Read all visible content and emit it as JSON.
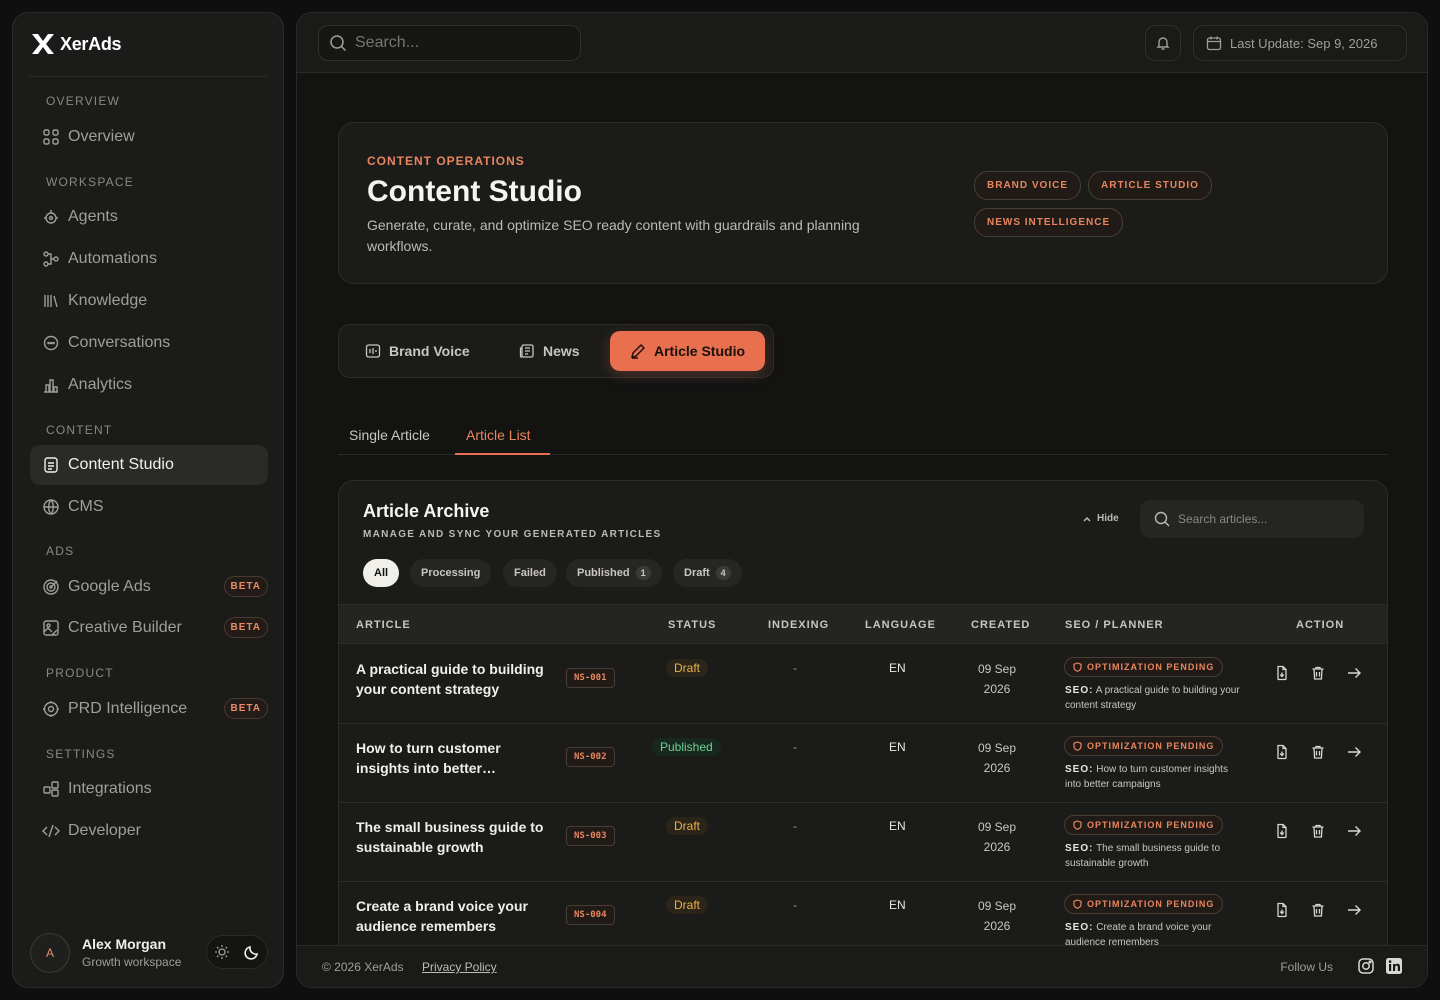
{
  "brand": {
    "name": "XerAds"
  },
  "sidebar": {
    "sections": [
      {
        "title": "OVERVIEW",
        "items": [
          {
            "label": "Overview",
            "icon": "grid-icon"
          }
        ]
      },
      {
        "title": "WORKSPACE",
        "items": [
          {
            "label": "Agents",
            "icon": "agent-icon"
          },
          {
            "label": "Automations",
            "icon": "workflow-icon"
          },
          {
            "label": "Knowledge",
            "icon": "library-icon"
          },
          {
            "label": "Conversations",
            "icon": "chat-icon"
          },
          {
            "label": "Analytics",
            "icon": "bar-chart-icon"
          }
        ]
      },
      {
        "title": "CONTENT",
        "items": [
          {
            "label": "Content Studio",
            "icon": "document-icon",
            "active": true
          },
          {
            "label": "CMS",
            "icon": "globe-icon"
          }
        ]
      },
      {
        "title": "ADS",
        "items": [
          {
            "label": "Google Ads",
            "icon": "target-icon",
            "badge": "BETA"
          },
          {
            "label": "Creative Builder",
            "icon": "image-edit-icon",
            "badge": "BETA"
          }
        ]
      },
      {
        "title": "PRODUCT",
        "items": [
          {
            "label": "PRD Intelligence",
            "icon": "gear-icon",
            "badge": "BETA"
          }
        ]
      },
      {
        "title": "SETTINGS",
        "items": [
          {
            "label": "Integrations",
            "icon": "plugin-icon"
          },
          {
            "label": "Developer",
            "icon": "code-icon"
          }
        ]
      }
    ],
    "user": {
      "initial": "A",
      "name": "Alex Morgan",
      "workspace": "Growth workspace"
    }
  },
  "topbar": {
    "search_placeholder": "Search...",
    "last_update": "Last Update: Sep 9, 2026"
  },
  "hero": {
    "eyebrow": "CONTENT OPERATIONS",
    "title": "Content Studio",
    "description": "Generate, curate, and optimize SEO ready content with guardrails and planning workflows.",
    "chips": [
      "BRAND VOICE",
      "ARTICLE STUDIO",
      "NEWS INTELLIGENCE"
    ]
  },
  "tabs": [
    {
      "label": "Brand Voice",
      "icon": "brand-voice-icon"
    },
    {
      "label": "News",
      "icon": "newspaper-icon"
    },
    {
      "label": "Article Studio",
      "icon": "pen-icon",
      "active": true
    }
  ],
  "subtabs": [
    {
      "label": "Single Article"
    },
    {
      "label": "Article List",
      "active": true
    }
  ],
  "archive": {
    "title": "Article Archive",
    "subtitle": "MANAGE AND SYNC YOUR GENERATED ARTICLES",
    "hide_label": "Hide",
    "search_placeholder": "Search articles...",
    "filters": [
      {
        "label": "All",
        "active": true
      },
      {
        "label": "Processing"
      },
      {
        "label": "Failed"
      },
      {
        "label": "Published",
        "count": "1"
      },
      {
        "label": "Draft",
        "count": "4"
      }
    ],
    "columns": [
      "ARTICLE",
      "STATUS",
      "INDEXING",
      "LANGUAGE",
      "CREATED",
      "SEO / PLANNER",
      "ACTION"
    ],
    "rows": [
      {
        "title": "A practical guide to building your content strategy",
        "id": "NS-001",
        "status": "Draft",
        "indexing": "-",
        "language": "EN",
        "created_day": "09 Sep",
        "created_year": "2026",
        "optimization": "OPTIMIZATION PENDING",
        "seo_label": "SEO:",
        "seo_text": "A practical guide to building your content strategy"
      },
      {
        "title": "How to turn customer insights into better…",
        "id": "NS-002",
        "status": "Published",
        "indexing": "-",
        "language": "EN",
        "created_day": "09 Sep",
        "created_year": "2026",
        "optimization": "OPTIMIZATION PENDING",
        "seo_label": "SEO:",
        "seo_text": "How to turn customer insights into better campaigns"
      },
      {
        "title": "The small business guide to sustainable growth",
        "id": "NS-003",
        "status": "Draft",
        "indexing": "-",
        "language": "EN",
        "created_day": "09 Sep",
        "created_year": "2026",
        "optimization": "OPTIMIZATION PENDING",
        "seo_label": "SEO:",
        "seo_text": "The small business guide to sustainable growth"
      },
      {
        "title": "Create a brand voice your audience remembers",
        "id": "NS-004",
        "status": "Draft",
        "indexing": "-",
        "language": "EN",
        "created_day": "09 Sep",
        "created_year": "2026",
        "optimization": "OPTIMIZATION PENDING",
        "seo_label": "SEO:",
        "seo_text": "Create a brand voice your audience remembers"
      }
    ]
  },
  "footer": {
    "copyright": "© 2026 XerAds",
    "privacy": "Privacy Policy",
    "follow": "Follow Us"
  },
  "colors": {
    "accent": "#e8704e",
    "draft": "#e8b04e",
    "published": "#6fcf97",
    "background": "#131312"
  }
}
